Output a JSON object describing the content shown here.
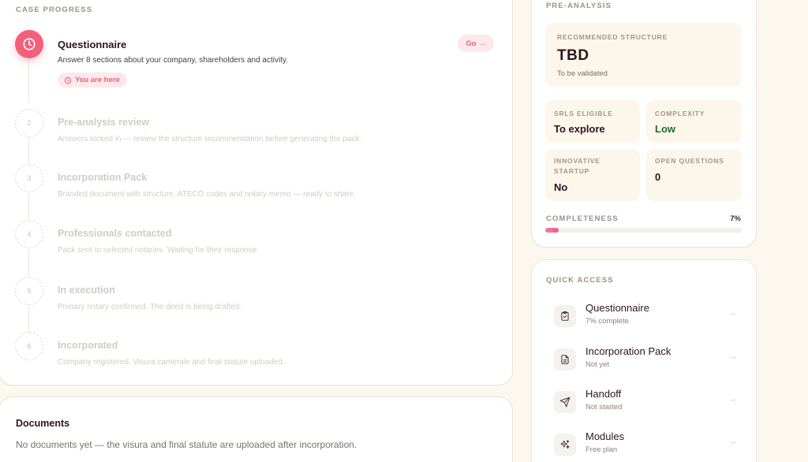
{
  "progress": {
    "section_label": "CASE PROGRESS",
    "active_step": {
      "title": "Questionnaire",
      "description": "Answer 8 sections about your company, shareholders and activity.",
      "badge": "You are here",
      "go_label": "Go →"
    },
    "steps": [
      {
        "number": "2",
        "title": "Pre-analysis review",
        "description": "Answers locked in — review the structure recommendation before generating the pack."
      },
      {
        "number": "3",
        "title": "Incorporation Pack",
        "description": "Branded document with structure, ATECO codes and notary memo — ready to share."
      },
      {
        "number": "4",
        "title": "Professionals contacted",
        "description": "Pack sent to selected notaries. Waiting for their response."
      },
      {
        "number": "5",
        "title": "In execution",
        "description": "Primary notary confirmed. The deed is being drafted."
      },
      {
        "number": "6",
        "title": "Incorporated",
        "description": "Company registered. Visura camerale and final statute uploaded."
      }
    ]
  },
  "documents": {
    "title": "Documents",
    "empty_text": "No documents yet — the visura and final statute are uploaded after incorporation."
  },
  "pre_analysis": {
    "section_label": "PRE-ANALYSIS",
    "structure": {
      "label": "RECOMMENDED STRUCTURE",
      "value": "TBD",
      "sub": "To be validated"
    },
    "srls": {
      "label": "SRLS ELIGIBLE",
      "value": "To explore"
    },
    "complexity": {
      "label": "COMPLEXITY",
      "value": "Low",
      "color": "#1f6b3a"
    },
    "innovative": {
      "label_line1": "INNOVATIVE",
      "label_line2": "STARTUP",
      "value": "No"
    },
    "open_questions": {
      "label": "OPEN QUESTIONS",
      "value": "0"
    },
    "completeness": {
      "label": "COMPLETENESS",
      "value_text": "7%",
      "fraction": 0.07
    }
  },
  "quick_access": {
    "section_label": "QUICK ACCESS",
    "items": [
      {
        "title": "Questionnaire",
        "sub": "7% complete",
        "icon": "clipboard-icon"
      },
      {
        "title": "Incorporation Pack",
        "sub": "Not yet",
        "icon": "document-icon"
      },
      {
        "title": "Handoff",
        "sub": "Not started",
        "icon": "send-icon"
      },
      {
        "title": "Modules",
        "sub": "Free plan",
        "icon": "sparkles-icon"
      }
    ],
    "arrow": "→"
  },
  "colors": {
    "accent": "#f2607a",
    "accent_soft": "#fde8ec",
    "background": "#fdf8ef",
    "tile": "#fdf6ea"
  }
}
